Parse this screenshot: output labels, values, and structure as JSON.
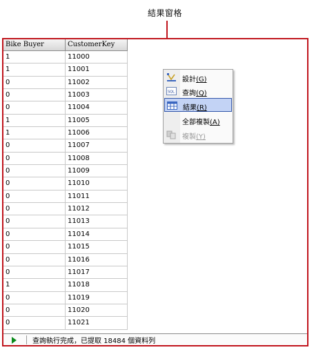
{
  "callout": {
    "title": "結果窗格"
  },
  "grid": {
    "columns": [
      "Bike Buyer",
      "CustomerKey"
    ],
    "rows": [
      [
        "1",
        "11000"
      ],
      [
        "1",
        "11001"
      ],
      [
        "0",
        "11002"
      ],
      [
        "0",
        "11003"
      ],
      [
        "0",
        "11004"
      ],
      [
        "1",
        "11005"
      ],
      [
        "1",
        "11006"
      ],
      [
        "0",
        "11007"
      ],
      [
        "0",
        "11008"
      ],
      [
        "0",
        "11009"
      ],
      [
        "0",
        "11010"
      ],
      [
        "0",
        "11011"
      ],
      [
        "0",
        "11012"
      ],
      [
        "0",
        "11013"
      ],
      [
        "0",
        "11014"
      ],
      [
        "0",
        "11015"
      ],
      [
        "0",
        "11016"
      ],
      [
        "0",
        "11017"
      ],
      [
        "1",
        "11018"
      ],
      [
        "0",
        "11019"
      ],
      [
        "0",
        "11020"
      ],
      [
        "0",
        "11021"
      ]
    ]
  },
  "context_menu": {
    "items": [
      {
        "label": "設計",
        "key": "(G)",
        "icon": "design-pane-icon",
        "selected": false,
        "disabled": false
      },
      {
        "label": "查詢",
        "key": "(Q)",
        "icon": "sql-pane-icon",
        "selected": false,
        "disabled": false
      },
      {
        "label": "結果",
        "key": "(R)",
        "icon": "results-grid-icon",
        "selected": true,
        "disabled": false
      },
      {
        "label": "全部複製",
        "key": "(A)",
        "icon": "",
        "selected": false,
        "disabled": false
      },
      {
        "label": "複製",
        "key": "(Y)",
        "icon": "copy-icon",
        "selected": false,
        "disabled": true
      }
    ]
  },
  "status": {
    "text": "查詢執行完成，已提取 18484 個資料列",
    "icon": "play-icon"
  },
  "colors": {
    "callout_red": "#c0141c",
    "selection_blue": "#c3d3f5",
    "status_green": "#0a8a1a"
  }
}
